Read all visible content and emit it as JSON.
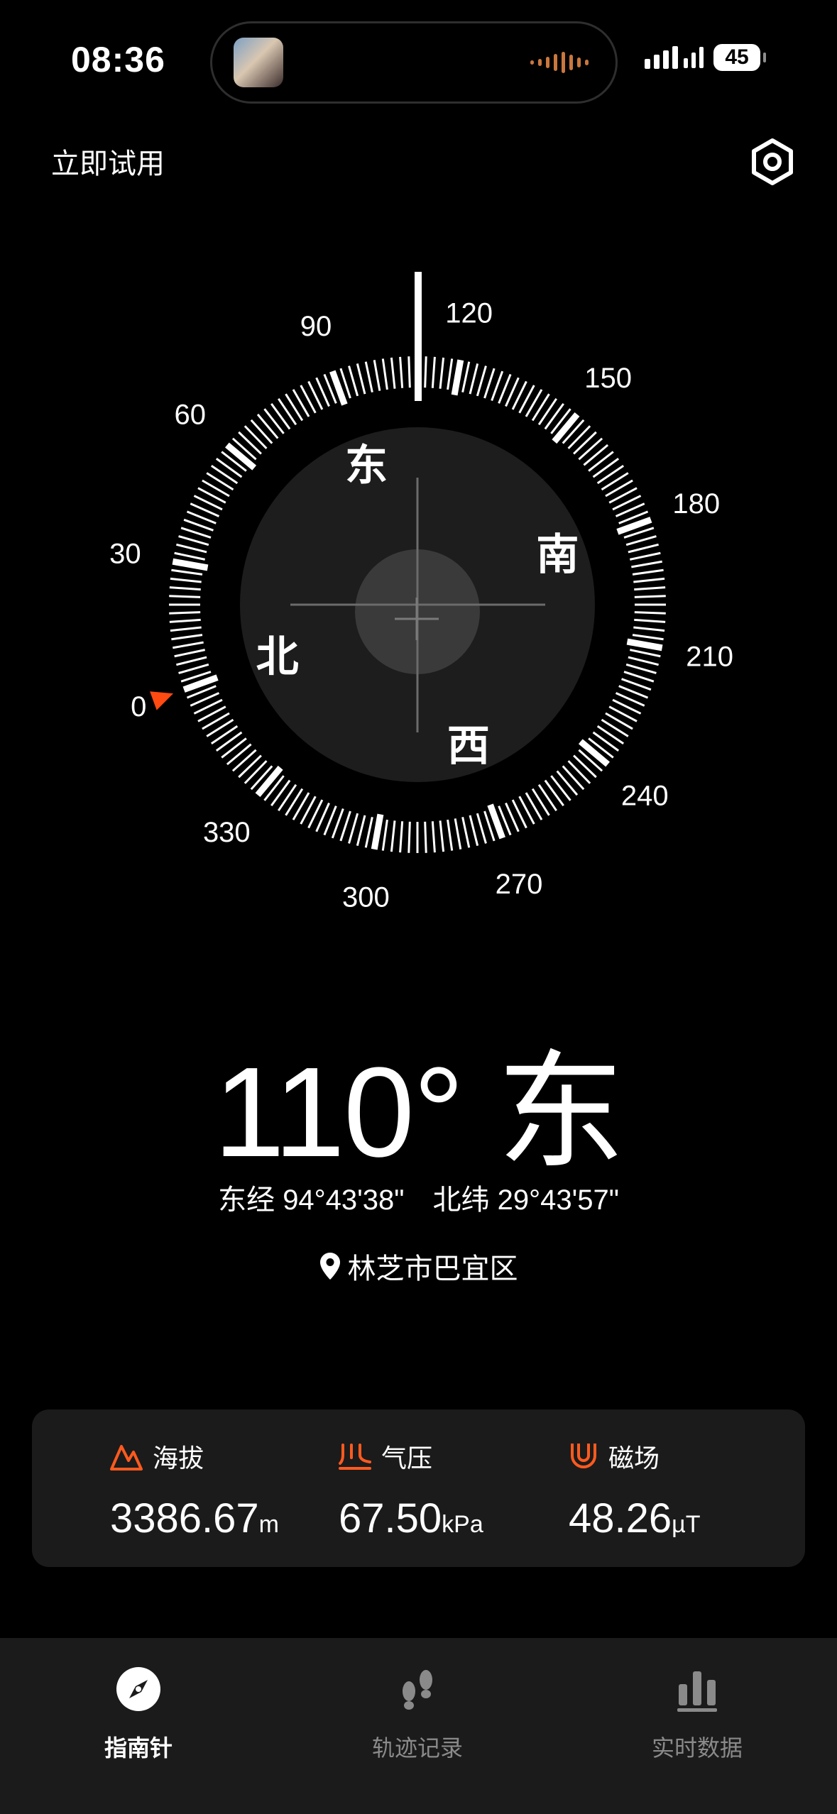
{
  "status_bar": {
    "time": "08:36",
    "battery": "45"
  },
  "header": {
    "trial_label": "立即试用",
    "settings_icon": "settings-hexagon-icon"
  },
  "compass": {
    "heading_degrees": 110,
    "degree_labels": [
      "0",
      "30",
      "60",
      "90",
      "120",
      "150",
      "180",
      "210",
      "240",
      "270",
      "300",
      "330"
    ],
    "cardinals": {
      "north": "北",
      "east": "东",
      "south": "南",
      "west": "西"
    },
    "north_marker_color": "#ff4a12"
  },
  "reading": {
    "heading_text": "110° 东"
  },
  "coordinates": {
    "longitude": "东经 94°43'38\"",
    "latitude": "北纬 29°43'57\""
  },
  "location": {
    "name": "林芝市巴宜区",
    "icon": "location-pin-icon"
  },
  "metrics": {
    "altitude": {
      "label": "海拔",
      "value": "3386.67",
      "unit": "m",
      "icon": "mountain-icon"
    },
    "pressure": {
      "label": "气压",
      "value": "67.50",
      "unit": "kPa",
      "icon": "pressure-icon"
    },
    "magnetic": {
      "label": "磁场",
      "value": "48.26",
      "unit": "µT",
      "icon": "magnet-icon"
    }
  },
  "accent_color": "#ff5a1f",
  "tabs": [
    {
      "label": "指南针",
      "icon": "compass-icon",
      "active": true
    },
    {
      "label": "轨迹记录",
      "icon": "footprints-icon",
      "active": false
    },
    {
      "label": "实时数据",
      "icon": "bar-chart-icon",
      "active": false
    }
  ]
}
